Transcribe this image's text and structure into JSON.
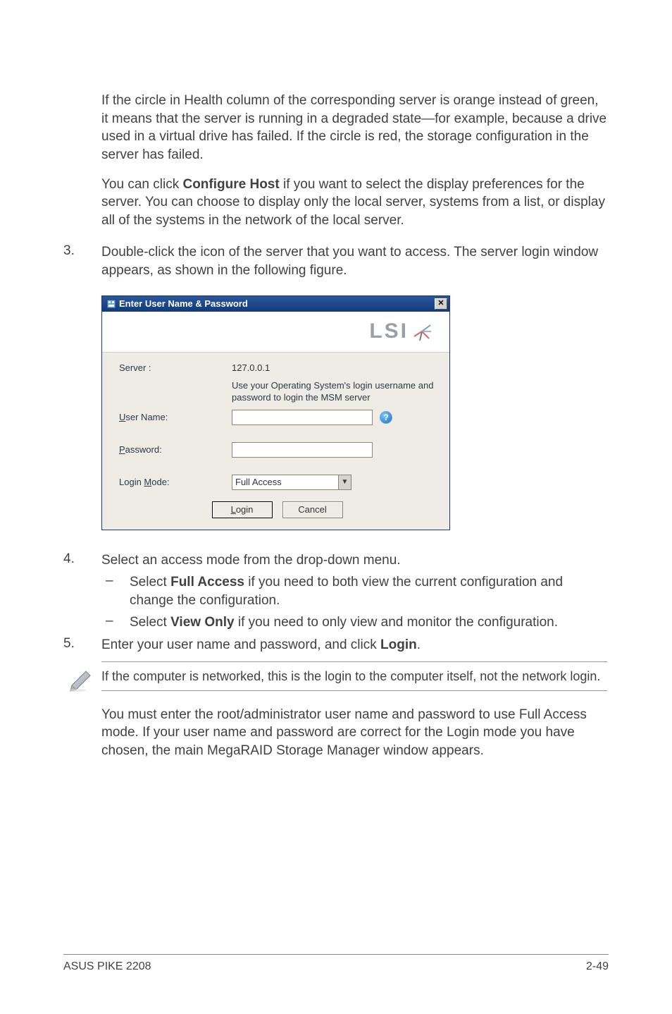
{
  "para1": "If the circle in Health column of the corresponding server is orange instead of green, it means that the server is running in a degraded state—for example, because a drive used in a virtual drive has failed. If the circle is red, the storage configuration in the server has failed.",
  "para2_pre": "You can click ",
  "para2_bold": "Configure Host",
  "para2_post": " if you want to select the display preferences for the server. You can choose to display only the local server, systems from a list, or display all of the systems in the network of the local server.",
  "step3_num": "3.",
  "step3_text": "Double-click the icon of the server that you want to access. The server login window appears, as shown in the following figure.",
  "dialog": {
    "title": "Enter User Name & Password",
    "logo_text": "LSI",
    "server_label": "Server :",
    "server_value": "127.0.0.1",
    "hint": "Use your Operating System's login username and password to login the MSM server",
    "user_label_pre": "",
    "user_label_u": "U",
    "user_label_post": "ser Name:",
    "pass_label_u": "P",
    "pass_label_post": "assword:",
    "mode_label_pre": "Login ",
    "mode_label_u": "M",
    "mode_label_post": "ode:",
    "mode_value": "Full Access",
    "login_btn_u": "L",
    "login_btn_post": "ogin",
    "cancel_btn": "Cancel",
    "help_glyph": "?",
    "close_glyph": "✕"
  },
  "step4_num": "4.",
  "step4_text": "Select an access mode from the drop-down menu.",
  "bullet1_pre": "Select ",
  "bullet1_bold": "Full Access",
  "bullet1_post": " if you need to both view the current configuration and change the configuration.",
  "bullet2_pre": "Select ",
  "bullet2_bold": "View Only",
  "bullet2_post": " if you need to only view and monitor the configuration.",
  "dash": "–",
  "step5_num": "5.",
  "step5_pre": "Enter your user name and password, and click ",
  "step5_bold": "Login",
  "step5_post": ".",
  "note": "If the computer is networked, this is the login to the computer itself, not the network login.",
  "para_last": "You must enter the root/administrator user name and password to use Full Access mode. If your user name and password are correct for the Login mode you have chosen, the main MegaRAID Storage Manager window appears.",
  "footer_left": "ASUS PIKE 2208",
  "footer_right": "2-49"
}
